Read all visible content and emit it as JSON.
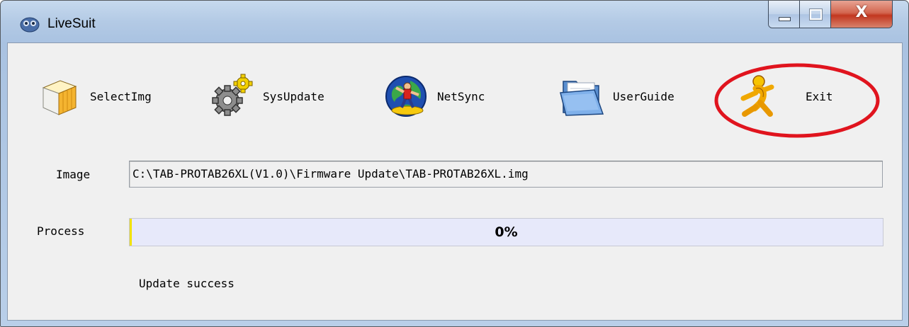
{
  "window": {
    "title": "LiveSuit"
  },
  "caption_buttons": {
    "minimize": "minimize-icon",
    "maximize": "maximize-icon",
    "close_glyph": "X"
  },
  "toolbar": [
    {
      "label": "SelectImg",
      "icon": "package-box-icon"
    },
    {
      "label": "SysUpdate",
      "icon": "gears-icon"
    },
    {
      "label": "NetSync",
      "icon": "globe-surfer-icon"
    },
    {
      "label": "UserGuide",
      "icon": "folder-icon"
    },
    {
      "label": "Exit",
      "icon": "running-man-icon"
    }
  ],
  "image_row": {
    "label": "Image",
    "value": "C:\\TAB-PROTAB26XL(V1.0)\\Firmware Update\\TAB-PROTAB26XL.img"
  },
  "process_row": {
    "label": "Process",
    "percent_text": "0%",
    "progress_fraction": 0.0
  },
  "status_text": "Update success",
  "colors": {
    "progress_fill": "#f2e200",
    "progress_track": "#e7e9fa",
    "annotation_ring": "#e0141e"
  }
}
